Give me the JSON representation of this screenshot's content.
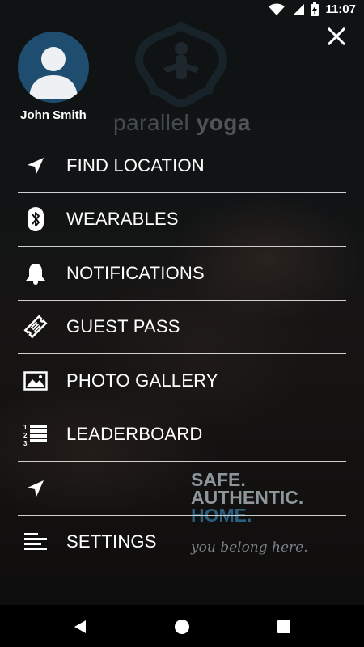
{
  "status_bar": {
    "time": "11:07",
    "icons": [
      "wifi-icon",
      "signal-icon",
      "battery-charging-icon"
    ]
  },
  "background": {
    "brand_left": "para",
    "brand_mid": "llel ",
    "brand_right": "yoga",
    "tagline": [
      "SAFE.",
      "AUTHENTIC.",
      "HOME."
    ],
    "script_tagline": "you belong here."
  },
  "profile": {
    "name": "John Smith",
    "avatar_color": "#1f4d70"
  },
  "menu": {
    "items": [
      {
        "label": "FIND LOCATION",
        "icon": "navigation-arrow-icon"
      },
      {
        "label": "WEARABLES",
        "icon": "bluetooth-icon"
      },
      {
        "label": "NOTIFICATIONS",
        "icon": "bell-icon"
      },
      {
        "label": "GUEST PASS",
        "icon": "ticket-icon"
      },
      {
        "label": "PHOTO GALLERY",
        "icon": "image-icon"
      },
      {
        "label": "LEADERBOARD",
        "icon": "ordered-list-icon"
      },
      {
        "label": "",
        "icon": "navigation-arrow-icon"
      },
      {
        "label": "SETTINGS",
        "icon": "align-left-icon"
      }
    ]
  },
  "colors": {
    "accent": "#2b5f80",
    "divider": "#cfcfcf",
    "text": "#ffffff"
  }
}
